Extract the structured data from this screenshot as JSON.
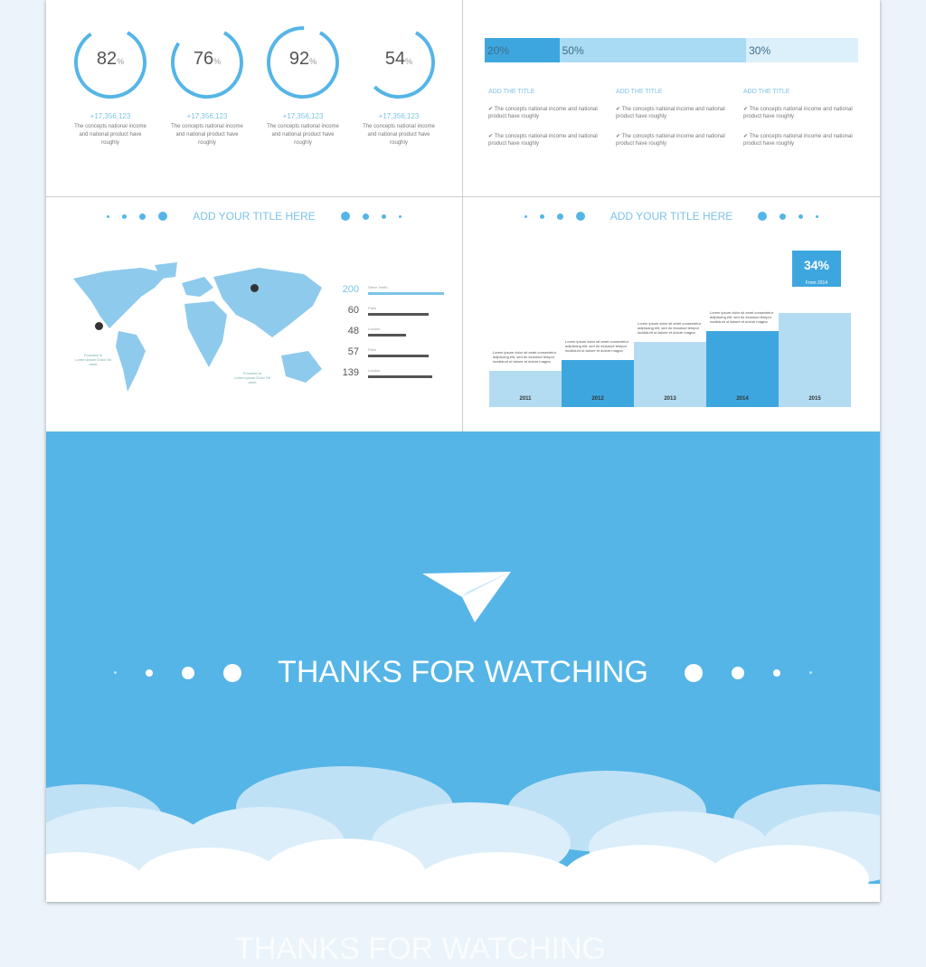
{
  "slide_stats": {
    "items": [
      {
        "percent": 82,
        "value": "+17,356,123",
        "desc": "The concepts national income and national product have roughly"
      },
      {
        "percent": 76,
        "value": "+17,356,123",
        "desc": "The concepts national income and national product have roughly"
      },
      {
        "percent": 92,
        "value": "+17,356,123",
        "desc": "The concepts national income and national product have roughly"
      },
      {
        "percent": 54,
        "value": "+17,356,123",
        "desc": "The concepts national income and national product have roughly"
      }
    ],
    "percent_sign": "%"
  },
  "slide_split": {
    "segments": [
      {
        "label": "20%",
        "value": 20,
        "color": "#3ea6df"
      },
      {
        "label": "50%",
        "value": 50,
        "color": "#a9dbf4"
      },
      {
        "label": "30%",
        "value": 30,
        "color": "#dcf0fb"
      }
    ],
    "columns": [
      {
        "title": "ADD THE TITLE",
        "bullets": [
          "✔ The concepts national income and national product have roughly",
          "✔ The concepts national income and national product have roughly"
        ]
      },
      {
        "title": "ADD THE TITLE",
        "bullets": [
          "✔ The concepts national income and national product have roughly",
          "✔ The concepts national income and national product have roughly"
        ]
      },
      {
        "title": "ADD THE TITLE",
        "bullets": [
          "✔ The concepts national income and national product have roughly",
          "✔ The concepts national income and national product have roughly"
        ]
      }
    ]
  },
  "slide_map": {
    "title": "ADD YOUR TITLE HERE",
    "pins": [
      {
        "label": "Founded in",
        "text": "Lorem ipsum Dolor Sit amet"
      },
      {
        "label": "Founded in",
        "text": "Lorem ipsum Dolor Sit amet"
      }
    ],
    "stats": [
      {
        "value": "200",
        "label": "Steve Smith",
        "fill": 1.0,
        "highlight": true
      },
      {
        "value": "60",
        "label": "Paris",
        "fill": 0.8
      },
      {
        "value": "48",
        "label": "London",
        "fill": 0.5
      },
      {
        "value": "57",
        "label": "Paris",
        "fill": 0.8
      },
      {
        "value": "139",
        "label": "London",
        "fill": 0.85
      }
    ]
  },
  "slide_growth": {
    "title": "ADD YOUR TITLE HERE",
    "bars": [
      {
        "year": "2011",
        "value": 1,
        "dark": false,
        "text": "Lorem ipsum dolor sit amet consectetur adipiscing elit, sed do eiusmod tempor incididunt ut labore et dolore magna"
      },
      {
        "year": "2012",
        "value": 1.3,
        "dark": true,
        "text": "Lorem ipsum dolor sit amet consectetur adipiscing elit, sed do eiusmod tempor incididunt ut labore et dolore magna"
      },
      {
        "year": "2013",
        "value": 1.8,
        "dark": false,
        "text": "Lorem ipsum dolor sit amet consectetur adipiscing elit, sed do eiusmod tempor incididunt ut labore et dolore magna"
      },
      {
        "year": "2014",
        "value": 2.1,
        "dark": true,
        "text": "Lorem ipsum dolor sit amet consectetur adipiscing elit, sed do eiusmod tempor incididunt ut labore et dolore magna"
      },
      {
        "year": "2015",
        "value": 2.6,
        "dark": false,
        "text": ""
      }
    ],
    "callout": {
      "value": "34%",
      "label": "From 2014"
    }
  },
  "slide_end": {
    "title": "THANKS FOR WATCHING",
    "icon": "paper-plane-icon",
    "bg": "#55b5e7"
  },
  "ghost_text": "THANKS FOR WATCHING"
}
